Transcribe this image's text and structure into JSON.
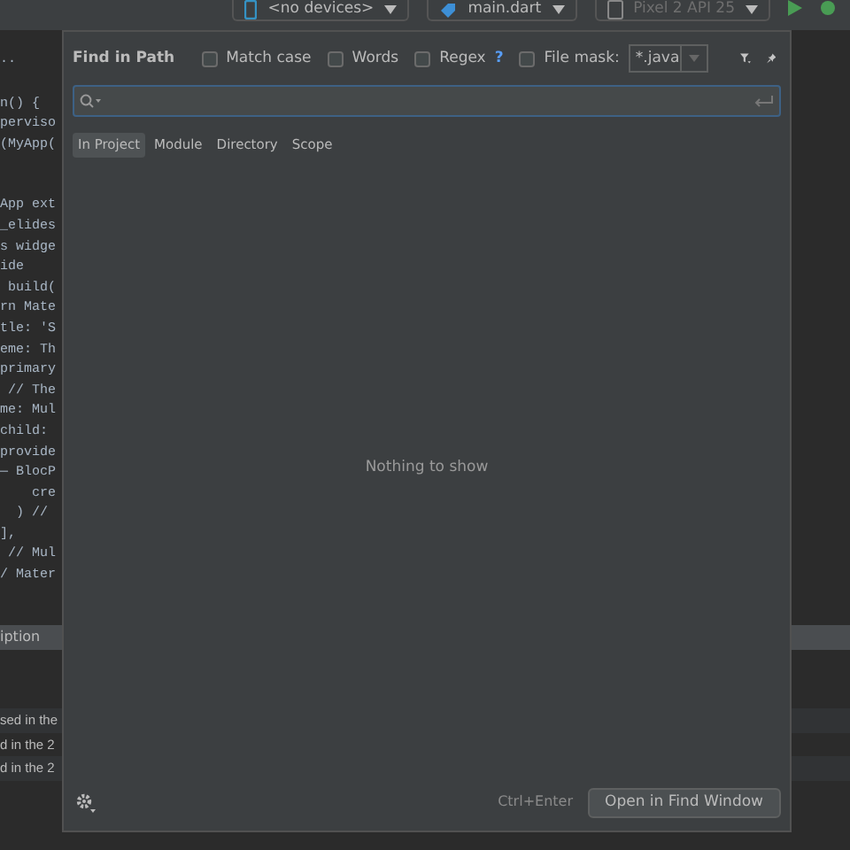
{
  "toolbar": {
    "items": [
      {
        "label": "<no devices>",
        "kind": "device",
        "disabled": false
      },
      {
        "label": "main.dart",
        "kind": "config",
        "disabled": false
      },
      {
        "label": "Pixel 2 API 25",
        "kind": "emulator",
        "disabled": true
      }
    ]
  },
  "editor": {
    "blocks": [
      [
        ".."
      ],
      [
        "n() {",
        "perviso",
        "(MyApp("
      ],
      [
        "App ext",
        "_elides",
        "s widge",
        "ide",
        " build(",
        "rn Mate",
        "tle: 'S",
        "eme: Th",
        "primary",
        " // The",
        "me: Mul",
        "child:",
        "provide",
        "— BlocP",
        "    cre",
        "  ) //",
        "],",
        " // Mul",
        "/ Mater"
      ]
    ]
  },
  "bottom_panel": {
    "header": "iption",
    "rows": [
      "sed in the",
      "d in the 2",
      "d in the 2"
    ]
  },
  "dialog": {
    "title": "Find in Path",
    "options": [
      {
        "label": "Match case",
        "checked": false
      },
      {
        "label": "Words",
        "checked": false
      },
      {
        "label": "Regex",
        "checked": false,
        "help": "?"
      },
      {
        "label": "File mask:",
        "checked": false
      }
    ],
    "file_mask": {
      "value": "*.java",
      "disabled": true
    },
    "scopes": [
      {
        "label": "In Project",
        "selected": true
      },
      {
        "label": "Module",
        "selected": false
      },
      {
        "label": "Directory",
        "selected": false
      },
      {
        "label": "Scope",
        "selected": false
      }
    ],
    "empty_text": "Nothing to show",
    "shortcut": "Ctrl+Enter",
    "open_button": "Open in Find Window"
  }
}
